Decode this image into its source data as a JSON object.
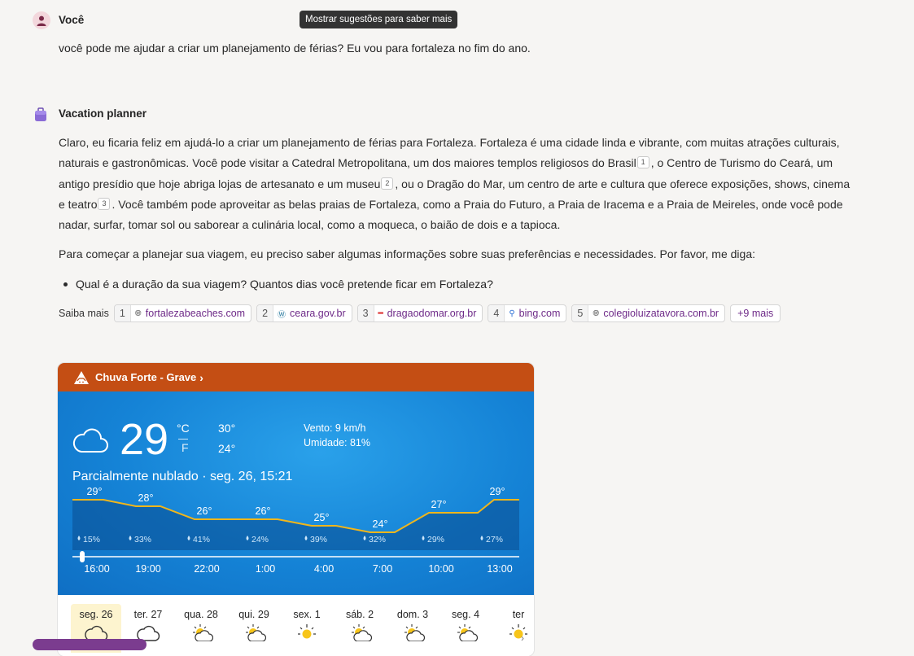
{
  "tooltip": "Mostrar sugestões para saber mais",
  "user": {
    "name": "Você",
    "message": "você pode me ajudar a criar um planejamento de férias? Eu vou para fortaleza no fim do ano."
  },
  "bot": {
    "name": "Vacation planner",
    "para1": {
      "s1": "Claro, eu ficaria feliz em ajudá-lo a criar um planejamento de férias para Fortaleza. Fortaleza é uma cidade linda e vibrante, com muitas atrações culturais, naturais e gastronômicas. Você pode visitar a Catedral Metropolitana, um dos maiores templos religiosos do Brasil",
      "c1": "1",
      "s2": ", o Centro de Turismo do Ceará, um antigo presídio que hoje abriga lojas de artesanato e um museu",
      "c2": "2",
      "s3": ", ou o Dragão do Mar, um centro de arte e cultura que oferece exposições, shows, cinema e teatro",
      "c3": "3",
      "s4": ". Você também pode aproveitar as belas praias de Fortaleza, como a Praia do Futuro, a Praia de Iracema e a Praia de Meireles, onde você pode nadar, surfar, tomar sol ou saborear a culinária local, como a moqueca, o baião de dois e a tapioca."
    },
    "para2": "Para começar a planejar sua viagem, eu preciso saber algumas informações sobre suas preferências e necessidades. Por favor, me diga:",
    "bullet1": "Qual é a duração da sua viagem? Quantos dias você pretende ficar em Fortaleza?"
  },
  "learn_more": {
    "label": "Saiba mais",
    "sources": [
      {
        "num": "1",
        "site": "fortalezabeaches.com",
        "icon": "globe-icon"
      },
      {
        "num": "2",
        "site": "ceara.gov.br",
        "icon": "wordpress-icon"
      },
      {
        "num": "3",
        "site": "dragaodomar.org.br",
        "icon": "site-logo-icon"
      },
      {
        "num": "4",
        "site": "bing.com",
        "icon": "search-icon"
      },
      {
        "num": "5",
        "site": "colegioluizatavora.com.br",
        "icon": "globe-icon"
      }
    ],
    "more": "+9 mais"
  },
  "weather": {
    "alert": "Chuva Forte - Grave",
    "temp": "29",
    "unit_c": "°C",
    "unit_f": "F",
    "high": "30°",
    "low": "24°",
    "wind": "Vento: 9 km/h",
    "humidity": "Umidade: 81%",
    "condition": "Parcialmente nublado · seg. 26, 15:21",
    "hourly": {
      "temps": [
        "29°",
        "28°",
        "26°",
        "26°",
        "25°",
        "24°",
        "27°",
        "29°"
      ],
      "values": [
        29,
        28,
        26,
        26,
        25,
        24,
        27,
        29
      ],
      "rain": [
        "15%",
        "33%",
        "41%",
        "24%",
        "39%",
        "32%",
        "29%",
        "27%"
      ],
      "times": [
        "16:00",
        "19:00",
        "22:00",
        "1:00",
        "4:00",
        "7:00",
        "10:00",
        "13:00"
      ]
    },
    "days": [
      "seg. 26",
      "ter. 27",
      "qua. 28",
      "qui. 29",
      "sex. 1",
      "sáb. 2",
      "dom. 3",
      "seg. 4",
      "ter"
    ],
    "day_icons": [
      "cloud-icon",
      "cloud-icon",
      "partly-sunny-icon",
      "partly-sunny-icon",
      "sun-icon",
      "partly-sunny-icon",
      "partly-sunny-icon",
      "partly-sunny-icon",
      "sun-icon"
    ]
  },
  "colors": {
    "alert_bar": "#c44e14",
    "weather_bg": "#1583d6",
    "link": "#6e2a88"
  }
}
